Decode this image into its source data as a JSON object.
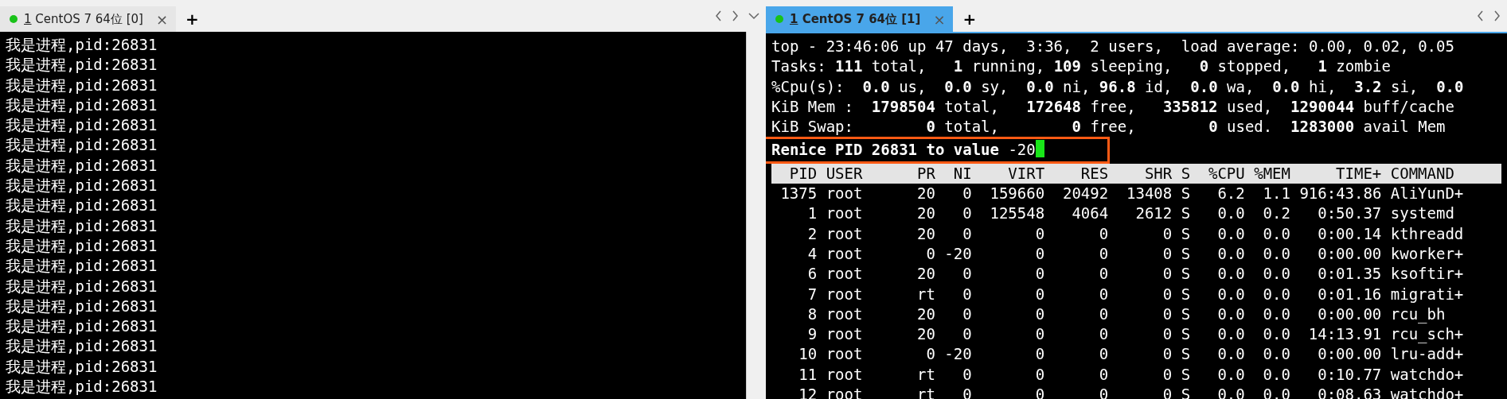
{
  "panes": [
    {
      "tabs": [
        {
          "hotkey": "1",
          "label": "CentOS 7 64位 [0]",
          "close": "×",
          "selected": false
        }
      ],
      "new_tab": "+",
      "lines": [
        "我是进程,pid:26831",
        "我是进程,pid:26831",
        "我是进程,pid:26831",
        "我是进程,pid:26831",
        "我是进程,pid:26831",
        "我是进程,pid:26831",
        "我是进程,pid:26831",
        "我是进程,pid:26831",
        "我是进程,pid:26831",
        "我是进程,pid:26831",
        "我是进程,pid:26831",
        "我是进程,pid:26831",
        "我是进程,pid:26831",
        "我是进程,pid:26831",
        "我是进程,pid:26831",
        "我是进程,pid:26831",
        "我是进程,pid:26831",
        "我是进程,pid:26831"
      ]
    },
    {
      "tabs": [
        {
          "hotkey": "1",
          "label": "CentOS 7 64位 [1]",
          "close": "×",
          "selected": true
        }
      ],
      "new_tab": "+",
      "top": {
        "summary": [
          "top - 23:46:06 up 47 days,  3:36,  2 users,  load average: 0.00, 0.02, 0.05",
          "Tasks: **111** total,   **1** running, **109** sleeping,   **0** stopped,   **1** zombie",
          "%Cpu(s):  **0.0** us,  **0.0** sy,  **0.0** ni, **96.8** id,  **0.0** wa,  **0.0** hi,  **3.2** si,  **0.0**",
          "KiB Mem :  **1798504** total,   **172648** free,   **335812** used,  **1290044** buff/cache",
          "KiB Swap:        **0** total,        **0** free,        **0** used.  **1283000** avail Mem"
        ],
        "prompt": "**Renice PID 26831 to value** -20",
        "annotation": {
          "kind": "rectangle"
        },
        "columns": [
          "PID",
          "USER",
          "PR",
          "NI",
          "VIRT",
          "RES",
          "SHR",
          "S",
          "%CPU",
          "%MEM",
          "TIME+",
          "COMMAND"
        ],
        "rows": [
          [
            "1375",
            "root",
            "20",
            "0",
            "159660",
            "20492",
            "13408",
            "S",
            "6.2",
            "1.1",
            "916:43.86",
            "AliYunD+"
          ],
          [
            "1",
            "root",
            "20",
            "0",
            "125548",
            "4064",
            "2612",
            "S",
            "0.0",
            "0.2",
            "0:50.37",
            "systemd"
          ],
          [
            "2",
            "root",
            "20",
            "0",
            "0",
            "0",
            "0",
            "S",
            "0.0",
            "0.0",
            "0:00.14",
            "kthreadd"
          ],
          [
            "4",
            "root",
            "0",
            "-20",
            "0",
            "0",
            "0",
            "S",
            "0.0",
            "0.0",
            "0:00.00",
            "kworker+"
          ],
          [
            "6",
            "root",
            "20",
            "0",
            "0",
            "0",
            "0",
            "S",
            "0.0",
            "0.0",
            "0:01.35",
            "ksoftir+"
          ],
          [
            "7",
            "root",
            "rt",
            "0",
            "0",
            "0",
            "0",
            "S",
            "0.0",
            "0.0",
            "0:01.16",
            "migrati+"
          ],
          [
            "8",
            "root",
            "20",
            "0",
            "0",
            "0",
            "0",
            "S",
            "0.0",
            "0.0",
            "0:00.00",
            "rcu_bh"
          ],
          [
            "9",
            "root",
            "20",
            "0",
            "0",
            "0",
            "0",
            "S",
            "0.0",
            "0.0",
            "14:13.91",
            "rcu_sch+"
          ],
          [
            "10",
            "root",
            "0",
            "-20",
            "0",
            "0",
            "0",
            "S",
            "0.0",
            "0.0",
            "0:00.00",
            "lru-add+"
          ],
          [
            "11",
            "root",
            "rt",
            "0",
            "0",
            "0",
            "0",
            "S",
            "0.0",
            "0.0",
            "0:10.77",
            "watchdo+"
          ],
          [
            "12",
            "root",
            "rt",
            "0",
            "0",
            "0",
            "0",
            "S",
            "0.0",
            "0.0",
            "0:08.63",
            "watchdo+"
          ]
        ]
      }
    }
  ]
}
